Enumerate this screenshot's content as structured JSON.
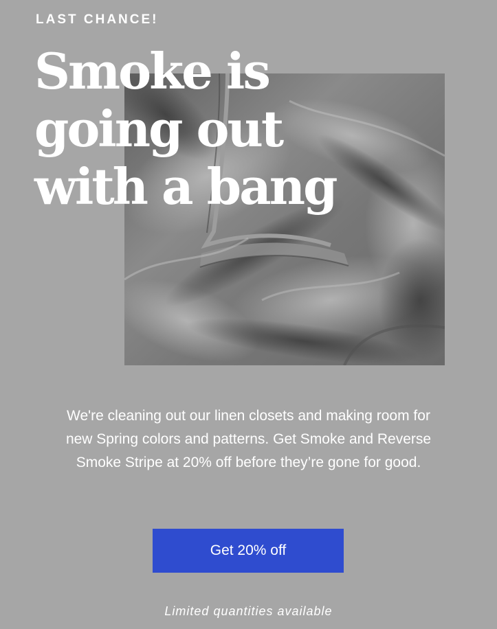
{
  "hero": {
    "eyebrow": "LAST CHANCE!",
    "headline_lines": [
      "Smoke is",
      "going out",
      "with a bang"
    ],
    "image_subject": "crumpled smoke grey bed sheet"
  },
  "body": {
    "text": "We're cleaning out our linen closets and making room for new Spring colors and patterns. Get Smoke and Reverse Smoke Stripe at 20% off before they’re gone for good."
  },
  "cta": {
    "label": "Get 20% off"
  },
  "footer": {
    "note": "Limited quantities available"
  },
  "colors": {
    "background": "#a6a6a6",
    "text": "#ffffff",
    "cta_background": "#2f4ccf"
  }
}
